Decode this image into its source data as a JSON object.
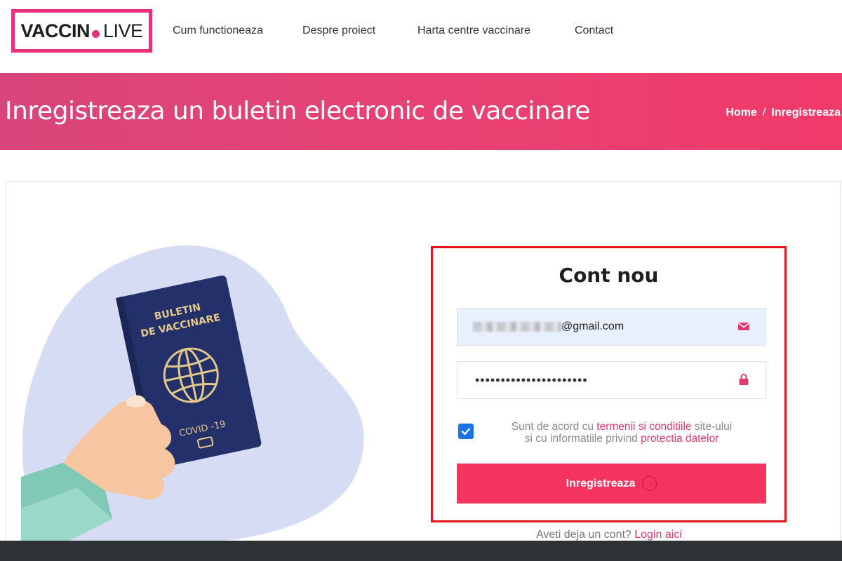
{
  "brand": {
    "logo_left": "VACCIN",
    "logo_right": "LIVE",
    "accent_color": "#e8317a"
  },
  "nav": {
    "items": [
      {
        "label": "Cum functioneaza"
      },
      {
        "label": "Despre proiect"
      },
      {
        "label": "Harta centre vaccinare"
      },
      {
        "label": "Contact"
      }
    ]
  },
  "banner": {
    "title": "Inregistreaza un buletin electronic de vaccinare",
    "breadcrumb_home": "Home",
    "breadcrumb_sep": "/",
    "breadcrumb_current": "Inregistreaza"
  },
  "illustration": {
    "passport_line1": "BULETIN",
    "passport_line2": "DE VACCINARE",
    "passport_footer": "COVID -19"
  },
  "form": {
    "title": "Cont nou",
    "email_value_visible": "@gmail.com",
    "email_icon": "envelope-icon",
    "password_value": "••••••••••••••••••••••",
    "password_icon": "lock-icon",
    "agree_checked": true,
    "agree_text_1": "Sunt de acord cu ",
    "agree_link_1": "termenii si conditiile",
    "agree_text_2": " site-ului",
    "agree_text_3": "si cu informatiile privind ",
    "agree_link_2": "protectia datelor",
    "submit_label": "Inregistreaza",
    "submit_color": "#f5335f",
    "login_prompt": "Aveti deja un cont? ",
    "login_link": "Login aici"
  }
}
